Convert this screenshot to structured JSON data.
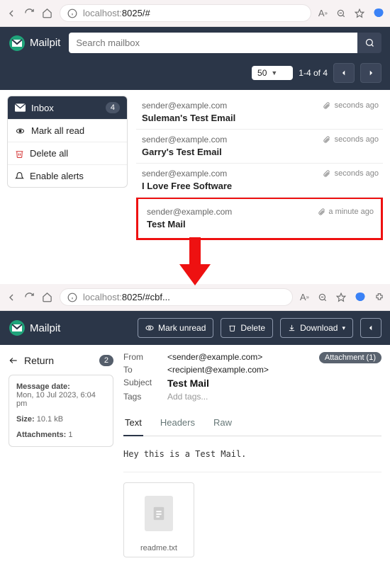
{
  "top": {
    "browser": {
      "url_host": "localhost:",
      "url_rest": "8025/#"
    },
    "app": {
      "name": "Mailpit",
      "search_placeholder": "Search mailbox"
    },
    "pagination": {
      "page_size": "50",
      "range": "1-4 of 4"
    },
    "sidebar": {
      "inbox": {
        "label": "Inbox",
        "count": "4"
      },
      "mark_all": "Mark all read",
      "delete_all": "Delete all",
      "enable_alerts": "Enable alerts"
    },
    "messages": [
      {
        "sender": "sender@example.com",
        "subject": "Suleman's Test Email",
        "time": "seconds ago"
      },
      {
        "sender": "sender@example.com",
        "subject": "Garry's Test Email",
        "time": "seconds ago"
      },
      {
        "sender": "sender@example.com",
        "subject": "I Love Free Software",
        "time": "seconds ago"
      },
      {
        "sender": "sender@example.com",
        "subject": "Test Mail",
        "time": "a minute ago"
      }
    ]
  },
  "bottom": {
    "browser": {
      "url_host": "localhost:",
      "url_rest": "8025/#cbf..."
    },
    "app": {
      "name": "Mailpit"
    },
    "actions": {
      "mark_unread": "Mark unread",
      "delete": "Delete",
      "download": "Download"
    },
    "return": {
      "label": "Return",
      "count": "2"
    },
    "meta": {
      "date_label": "Message date:",
      "date_value": "Mon, 10 Jul 2023, 6:04 pm",
      "size_label": "Size:",
      "size_value": "10.1 kB",
      "att_label": "Attachments:",
      "att_value": "1"
    },
    "headers": {
      "from_k": "From",
      "from_v": "<sender@example.com>",
      "to_k": "To",
      "to_v": "<recipient@example.com>",
      "subject_k": "Subject",
      "subject_v": "Test Mail",
      "tags_k": "Tags",
      "tags_v": "Add tags..."
    },
    "attachment_badge": "Attachment (1)",
    "tabs": {
      "text": "Text",
      "headers": "Headers",
      "raw": "Raw"
    },
    "body": "Hey this is a Test Mail.",
    "attachment_file": "readme.txt"
  }
}
